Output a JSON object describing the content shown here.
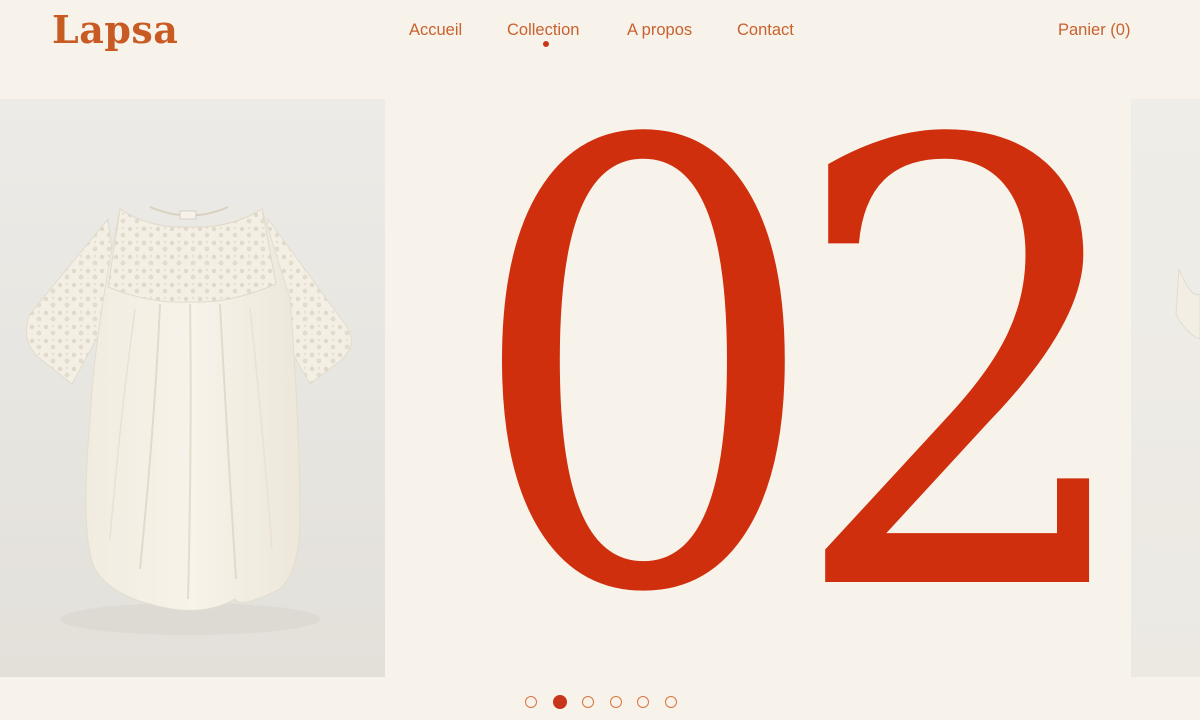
{
  "brand": {
    "logo": "Lapsa"
  },
  "nav": {
    "items": [
      {
        "label": "Accueil"
      },
      {
        "label": "Collection",
        "active": true
      },
      {
        "label": "A propos"
      },
      {
        "label": "Contact"
      }
    ],
    "cart_label": "Panier (0)"
  },
  "slider": {
    "current_number": "02",
    "slide_count": 6,
    "active_index": 1,
    "photo_subject": "cream lace baby dress",
    "accent_color": "#cf2f0c",
    "background_color": "#f8f3ea"
  }
}
